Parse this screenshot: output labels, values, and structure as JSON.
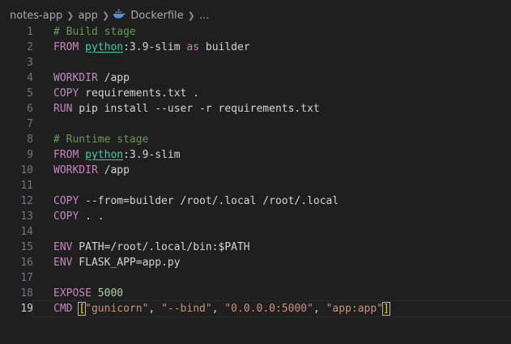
{
  "breadcrumb": {
    "items": [
      "notes-app",
      "app",
      "Dockerfile",
      "..."
    ]
  },
  "editor": {
    "current_line": 19,
    "lines": [
      {
        "n": "1",
        "tokens": [
          {
            "c": "t-comment",
            "t": "# Build stage"
          }
        ]
      },
      {
        "n": "2",
        "tokens": [
          {
            "c": "t-kw",
            "t": "FROM "
          },
          {
            "c": "t-img",
            "t": "python"
          },
          {
            "c": "t-text",
            "t": ":3.9-slim "
          },
          {
            "c": "t-kw",
            "t": "as"
          },
          {
            "c": "t-text",
            "t": " builder"
          }
        ]
      },
      {
        "n": "3",
        "tokens": []
      },
      {
        "n": "4",
        "tokens": [
          {
            "c": "t-kw",
            "t": "WORKDIR"
          },
          {
            "c": "t-text",
            "t": " /app"
          }
        ]
      },
      {
        "n": "5",
        "tokens": [
          {
            "c": "t-kw",
            "t": "COPY"
          },
          {
            "c": "t-text",
            "t": " requirements.txt ."
          }
        ]
      },
      {
        "n": "6",
        "tokens": [
          {
            "c": "t-kw",
            "t": "RUN"
          },
          {
            "c": "t-text",
            "t": " pip install --user -r requirements.txt"
          }
        ]
      },
      {
        "n": "7",
        "tokens": []
      },
      {
        "n": "8",
        "tokens": [
          {
            "c": "t-comment",
            "t": "# Runtime stage"
          }
        ]
      },
      {
        "n": "9",
        "tokens": [
          {
            "c": "t-kw",
            "t": "FROM "
          },
          {
            "c": "t-img",
            "t": "python"
          },
          {
            "c": "t-text",
            "t": ":3.9-slim"
          }
        ]
      },
      {
        "n": "10",
        "tokens": [
          {
            "c": "t-kw",
            "t": "WORKDIR"
          },
          {
            "c": "t-text",
            "t": " /app"
          }
        ]
      },
      {
        "n": "11",
        "tokens": []
      },
      {
        "n": "12",
        "tokens": [
          {
            "c": "t-kw",
            "t": "COPY"
          },
          {
            "c": "t-text",
            "t": " --from=builder /root/.local /root/.local"
          }
        ]
      },
      {
        "n": "13",
        "tokens": [
          {
            "c": "t-kw",
            "t": "COPY"
          },
          {
            "c": "t-text",
            "t": " . ."
          }
        ]
      },
      {
        "n": "14",
        "tokens": []
      },
      {
        "n": "15",
        "tokens": [
          {
            "c": "t-kw",
            "t": "ENV"
          },
          {
            "c": "t-text",
            "t": " PATH=/root/.local/bin:$PATH"
          }
        ]
      },
      {
        "n": "16",
        "tokens": [
          {
            "c": "t-kw",
            "t": "ENV"
          },
          {
            "c": "t-text",
            "t": " FLASK_APP=app.py"
          }
        ]
      },
      {
        "n": "17",
        "tokens": []
      },
      {
        "n": "18",
        "tokens": [
          {
            "c": "t-kw",
            "t": "EXPOSE"
          },
          {
            "c": "t-num",
            "t": " 5000"
          }
        ]
      },
      {
        "n": "19",
        "tokens": [
          {
            "c": "t-kw",
            "t": "CMD"
          },
          {
            "c": "t-text",
            "t": " "
          },
          {
            "c": "bracket-match",
            "t": "["
          },
          {
            "c": "t-str",
            "t": "\"gunicorn\""
          },
          {
            "c": "t-text",
            "t": ", "
          },
          {
            "c": "t-str",
            "t": "\"--bind\""
          },
          {
            "c": "t-text",
            "t": ", "
          },
          {
            "c": "t-str",
            "t": "\"0.0.0.0:5000\""
          },
          {
            "c": "t-text",
            "t": ", "
          },
          {
            "c": "t-str",
            "t": "\"app:app\""
          },
          {
            "c": "bracket-match",
            "t": "]"
          },
          {
            "c": "cursor",
            "t": ""
          }
        ]
      }
    ]
  },
  "colors": {
    "background": "#1f1f1f",
    "keyword": "#c586c0",
    "comment": "#6a9955",
    "string": "#ce9178",
    "number": "#b5cea8",
    "image": "#4ec9b0",
    "text": "#d4d4d4",
    "line_number": "#6e7681"
  },
  "icons": {
    "separator": "chevron-right-icon",
    "file": "docker-whale-icon"
  }
}
